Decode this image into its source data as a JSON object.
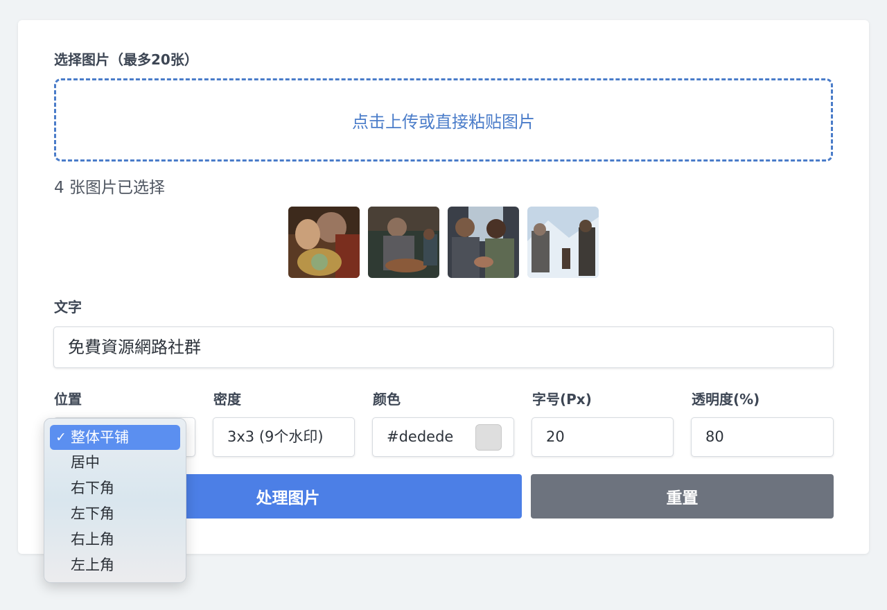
{
  "form": {
    "images_label": "选择图片（最多20张）",
    "upload_prompt": "点击上传或直接粘贴图片",
    "selected_count": "4 张图片已选择",
    "text_label": "文字",
    "text_value": "免費資源網路社群",
    "position_label": "位置",
    "density_label": "密度",
    "density_value": "3x3 (9个水印)",
    "color_label": "颜色",
    "color_value": "#dedede",
    "font_size_label": "字号(Px)",
    "font_size_value": "20",
    "opacity_label": "透明度(%)",
    "opacity_value": "80",
    "process_button": "处理图片",
    "reset_button": "重置"
  },
  "thumbnails": [
    {
      "name": "image-1",
      "icon": "photo-thumbnail"
    },
    {
      "name": "image-2",
      "icon": "photo-thumbnail"
    },
    {
      "name": "image-3",
      "icon": "photo-thumbnail"
    },
    {
      "name": "image-4",
      "icon": "photo-thumbnail"
    }
  ],
  "position_options": [
    {
      "label": "整体平铺",
      "selected": true
    },
    {
      "label": "居中",
      "selected": false
    },
    {
      "label": "右下角",
      "selected": false
    },
    {
      "label": "左下角",
      "selected": false
    },
    {
      "label": "右上角",
      "selected": false
    },
    {
      "label": "左上角",
      "selected": false
    }
  ],
  "checkmark": "✓",
  "colors": {
    "accent": "#4a7cc9",
    "primary_button": "#4c7fe6",
    "reset_button": "#6d737e",
    "swatch": "#dedede",
    "selected_option": "#5b8ff0"
  }
}
